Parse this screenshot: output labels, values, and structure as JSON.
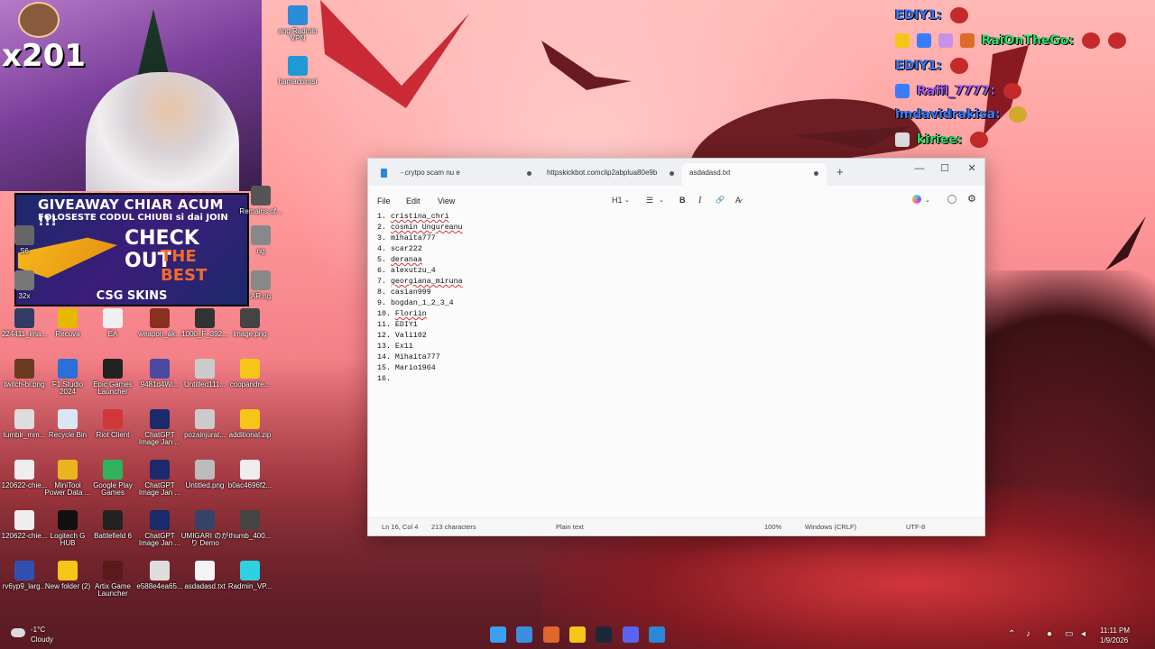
{
  "stream": {
    "counter": "x201",
    "giveaway_line1": "GIVEAWAY CHIAR ACUM !!!",
    "giveaway_line2": "FOLOSESTE CODUL CHIUBI si dai JOIN",
    "checkout": "CHECK OUT",
    "best": "THE BEST",
    "brand": "CSG SKINS",
    "chat": [
      {
        "user": "EDIY1:",
        "color": "#3b7bff"
      },
      {
        "user": "RaiOnTheGo:",
        "color": "#2fe06a"
      },
      {
        "user": "EDIY1:",
        "color": "#3b7bff"
      },
      {
        "user": "Rafil_7777:",
        "color": "#a05cf0"
      },
      {
        "user": "imdavidrakisa:",
        "color": "#3b7bff"
      },
      {
        "user": "kiriee:",
        "color": "#2fe06a"
      }
    ]
  },
  "desktop_icons": [
    {
      "label": "ang Radmin VPN",
      "color": "#2b8cd8"
    },
    {
      "label": "hamachimsi",
      "color": "#1f9ad6"
    },
    {
      "label": "Remains of...",
      "color": "#555555"
    },
    {
      "label": "S6",
      "color": "#666666"
    },
    {
      "label": "32x",
      "color": "#777777"
    },
    {
      "label": "ng",
      "color": "#888888"
    },
    {
      "label": "AR.ng",
      "color": "#888888"
    },
    {
      "label": "224411_ima...",
      "color": "#333a66"
    },
    {
      "label": "Recuva",
      "color": "#e6b800"
    },
    {
      "label": "EA",
      "color": "#f0f0f0"
    },
    {
      "label": "weapon_ak...",
      "color": "#8a3020"
    },
    {
      "label": "1000_F_392...",
      "color": "#333333"
    },
    {
      "label": "image.png",
      "color": "#444444"
    },
    {
      "label": "twitch-bi.png",
      "color": "#6b3a20"
    },
    {
      "label": "F1 Studio 2024",
      "color": "#2b6fd8"
    },
    {
      "label": "Epic Games Launcher",
      "color": "#222222"
    },
    {
      "label": "9481d4Wi...",
      "color": "#4a4aa0"
    },
    {
      "label": "Untitled111...",
      "color": "#cccccc"
    },
    {
      "label": "coopandre...",
      "color": "#f5c518"
    },
    {
      "label": "tumblr_mm...",
      "color": "#dddddd"
    },
    {
      "label": "Recycle Bin",
      "color": "#d9e7f5"
    },
    {
      "label": "Riot Client",
      "color": "#d13639"
    },
    {
      "label": "ChatGPT Image Jan ...",
      "color": "#1b2a6a"
    },
    {
      "label": "pozainjurat...",
      "color": "#cccccc"
    },
    {
      "label": "additional.zip",
      "color": "#f5c518"
    },
    {
      "label": "120622-chie...",
      "color": "#eeeeee"
    },
    {
      "label": "MiniTool Power Data ...",
      "color": "#e8b520"
    },
    {
      "label": "Google Play Games",
      "color": "#2fb35c"
    },
    {
      "label": "ChatGPT Image Jan ...",
      "color": "#1b2a6a"
    },
    {
      "label": "Untitled.png",
      "color": "#bbbbbb"
    },
    {
      "label": "b0ac4696f2...",
      "color": "#eeeeee"
    },
    {
      "label": "120622-chie...",
      "color": "#eeeeee"
    },
    {
      "label": "Logitech G HUB",
      "color": "#111111"
    },
    {
      "label": "Battlefield 6",
      "color": "#222222"
    },
    {
      "label": "ChatGPT Image Jan ...",
      "color": "#1b2a6a"
    },
    {
      "label": "UMIGARI のがり Demo",
      "color": "#334466"
    },
    {
      "label": "thumb_400...",
      "color": "#444444"
    },
    {
      "label": "rv6yp9_larg...",
      "color": "#3050b0"
    },
    {
      "label": "New folder (2)",
      "color": "#f5c518"
    },
    {
      "label": "Artix Game Launcher",
      "color": "#5a1a1a"
    },
    {
      "label": "e588e4ea65...",
      "color": "#dddddd"
    },
    {
      "label": "asdadasd.txt",
      "color": "#f4f4f4"
    },
    {
      "label": "Radmin_VP...",
      "color": "#2fd0e0"
    }
  ],
  "notepad": {
    "tabs": [
      {
        "label": "- crytpo scam nu e"
      },
      {
        "label": "httpskickbot.comclip2abplua80e9b"
      },
      {
        "label": "asdadasd.txt"
      }
    ],
    "add_tab": "+",
    "min": "—",
    "max": "☐",
    "close": "✕",
    "menu": {
      "file": "File",
      "edit": "Edit",
      "view": "View"
    },
    "toolbar": {
      "heading": "H1",
      "list": "☰",
      "bold": "B",
      "italic": "I",
      "link": "🔗",
      "clear": "A̷"
    },
    "lines": [
      {
        "num": "1.",
        "text": "cristina_chri"
      },
      {
        "num": "2.",
        "text": "cosmin Ungureanu"
      },
      {
        "num": "3.",
        "text": "mihaita777"
      },
      {
        "num": "4.",
        "text": "scar222"
      },
      {
        "num": "5.",
        "text": "deranaa"
      },
      {
        "num": "6.",
        "text": "alexutzu_4"
      },
      {
        "num": "7.",
        "text": "georgiana_miruna"
      },
      {
        "num": "8.",
        "text": "casian999"
      },
      {
        "num": "9.",
        "text": "bogdan_1_2_3_4"
      },
      {
        "num": "10.",
        "text": "Floriin"
      },
      {
        "num": "11.",
        "text": "EDIY1"
      },
      {
        "num": "12.",
        "text": "Vali102"
      },
      {
        "num": "13.",
        "text": "Ex11"
      },
      {
        "num": "14.",
        "text": "Mihaita777"
      },
      {
        "num": "15.",
        "text": "Mario1964"
      },
      {
        "num": "16.",
        "text": ""
      }
    ],
    "status": {
      "position": "Ln 16, Col 4",
      "chars": "213 characters",
      "format": "Plain text",
      "zoom": "100%",
      "eol": "Windows (CRLF)",
      "encoding": "UTF-8"
    }
  },
  "taskbar": {
    "weather_temp": "-1°C",
    "weather_desc": "Cloudy",
    "time": "11:11 PM",
    "date": "1/9/2026",
    "apps": [
      {
        "name": "start",
        "color": "#3aa0f0"
      },
      {
        "name": "explorer-window",
        "color": "#3b8ee0"
      },
      {
        "name": "browser",
        "color": "#e0662b"
      },
      {
        "name": "file-explorer",
        "color": "#f5c518"
      },
      {
        "name": "steam",
        "color": "#1b2838"
      },
      {
        "name": "discord",
        "color": "#5865f2"
      },
      {
        "name": "notepad",
        "color": "#2b88d8"
      }
    ]
  }
}
